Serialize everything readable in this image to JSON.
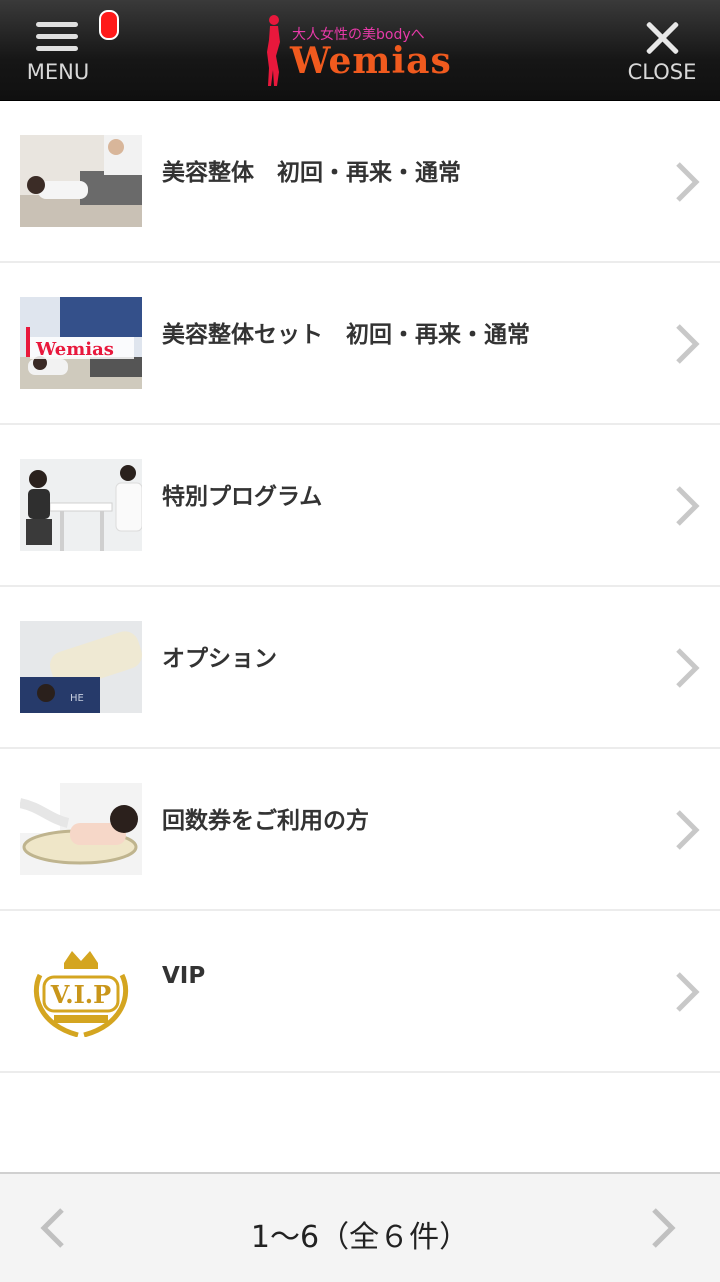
{
  "header": {
    "menu_label": "MENU",
    "close_label": "CLOSE",
    "logo": {
      "tagline": "大人女性の美bodyへ",
      "name": "Wemias"
    },
    "badge_color": "#ff1a1a"
  },
  "items": [
    {
      "title": "美容整体　初回・再来・通常",
      "thumb_icon": "massage-photo"
    },
    {
      "title": "美容整体セット　初回・再来・通常",
      "thumb_icon": "wemias-collage-photo"
    },
    {
      "title": "特別プログラム",
      "thumb_icon": "counseling-photo"
    },
    {
      "title": "オプション",
      "thumb_icon": "pillow-photo"
    },
    {
      "title": "回数券をご利用の方",
      "thumb_icon": "back-massage-photo"
    },
    {
      "title": "VIP",
      "thumb_icon": "vip-crown-emblem"
    }
  ],
  "pager": {
    "text": "1〜6（全６件）"
  },
  "vip_badge": {
    "text": "V.I.P"
  },
  "colors": {
    "header_bg": "#1a1a1a",
    "logo_orange": "#f05a1e",
    "logo_pink": "#e63aa8",
    "chevron": "#c8c8c8"
  }
}
